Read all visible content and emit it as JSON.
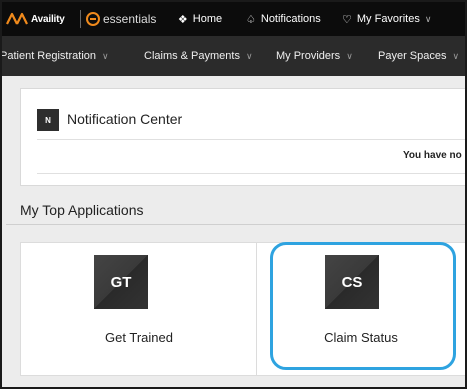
{
  "topbar": {
    "brand": "Availity",
    "essentials": "essentials",
    "home_icon": "home-icon",
    "home_label": "Home",
    "notifications_icon": "bell-icon",
    "notifications_label": "Notifications",
    "favorites_icon": "heart-icon",
    "favorites_label": "My Favorites",
    "chevron": "∨"
  },
  "subnav": {
    "items": [
      {
        "label": "Patient Registration"
      },
      {
        "label": "Claims & Payments"
      },
      {
        "label": "My Providers"
      },
      {
        "label": "Payer Spaces"
      }
    ],
    "chevron": "∨"
  },
  "notification_center": {
    "badge": "N",
    "title": "Notification Center",
    "message": "You have no"
  },
  "top_apps": {
    "heading": "My Top Applications",
    "tiles": [
      {
        "abbr": "GT",
        "label": "Get Trained"
      },
      {
        "abbr": "CS",
        "label": "Claim Status"
      }
    ]
  },
  "colors": {
    "highlight": "#2ea3e0",
    "topbar": "#0c0c0c",
    "subnav": "#2b2b2b",
    "essentials_accent": "#f08a1c"
  }
}
